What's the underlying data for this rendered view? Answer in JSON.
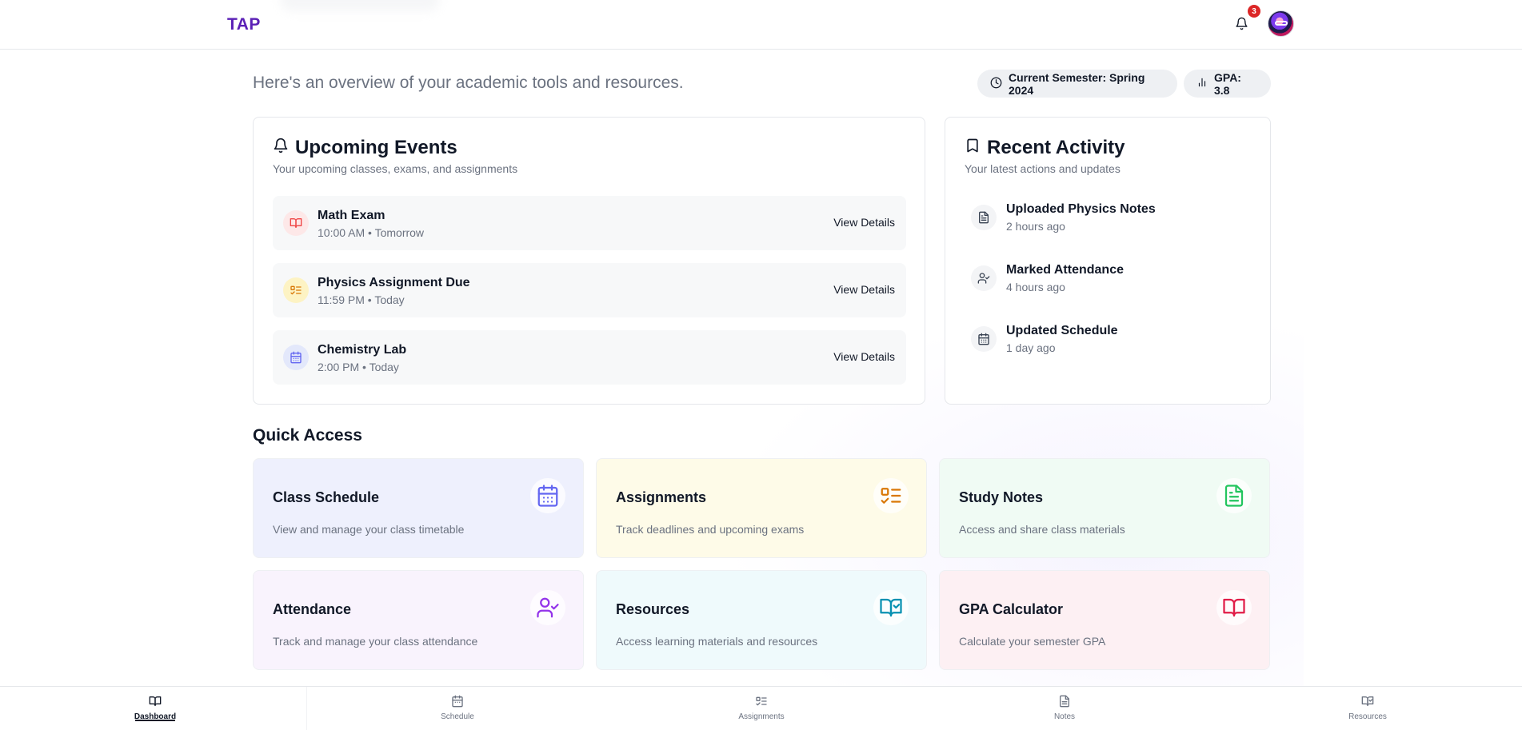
{
  "header": {
    "logo": "TAP",
    "notification_count": "3"
  },
  "overview": {
    "text": "Here's an overview of your academic tools and resources.",
    "semester": "Current Semester: Spring 2024",
    "gpa": "GPA: 3.8"
  },
  "events": {
    "title": "Upcoming Events",
    "subtitle": "Your upcoming classes, exams, and assignments",
    "items": [
      {
        "name": "Math Exam",
        "time": "10:00 AM • Tomorrow",
        "action": "View Details",
        "icon": "book-open-icon",
        "color": "#ef4444",
        "bg": "#fde8e8"
      },
      {
        "name": "Physics Assignment Due",
        "time": "11:59 PM • Today",
        "action": "View Details",
        "icon": "list-checks-icon",
        "color": "#d97706",
        "bg": "#fdf3c4"
      },
      {
        "name": "Chemistry Lab",
        "time": "2:00 PM • Today",
        "action": "View Details",
        "icon": "calendar-icon",
        "color": "#6366f1",
        "bg": "#e3e8fb"
      }
    ]
  },
  "activity": {
    "title": "Recent Activity",
    "subtitle": "Your latest actions and updates",
    "items": [
      {
        "name": "Uploaded Physics Notes",
        "time": "2 hours ago",
        "icon": "file-text-icon"
      },
      {
        "name": "Marked Attendance",
        "time": "4 hours ago",
        "icon": "user-check-icon"
      },
      {
        "name": "Updated Schedule",
        "time": "1 day ago",
        "icon": "calendar-icon"
      }
    ]
  },
  "quick_access": {
    "title": "Quick Access",
    "tiles": [
      {
        "name": "Class Schedule",
        "desc": "View and manage your class timetable",
        "icon": "calendar-icon",
        "color": "#6366f1",
        "bg": "#eef0fd"
      },
      {
        "name": "Assignments",
        "desc": "Track deadlines and upcoming exams",
        "icon": "list-checks-icon",
        "color": "#d97706",
        "bg": "#fefbe8"
      },
      {
        "name": "Study Notes",
        "desc": "Access and share class materials",
        "icon": "file-text-icon",
        "color": "#22c55e",
        "bg": "#f0fbf4"
      },
      {
        "name": "Attendance",
        "desc": "Track and manage your class attendance",
        "icon": "user-check-icon",
        "color": "#9333ea",
        "bg": "#f9f3fd"
      },
      {
        "name": "Resources",
        "desc": "Access learning materials and resources",
        "icon": "book-check-icon",
        "color": "#0891b2",
        "bg": "#effafc"
      },
      {
        "name": "GPA Calculator",
        "desc": "Calculate your semester GPA",
        "icon": "book-open-icon",
        "color": "#e11d48",
        "bg": "#fdf0f3"
      }
    ]
  },
  "bottom_nav": {
    "items": [
      {
        "label": "Dashboard",
        "icon": "book-open-icon",
        "active": true
      },
      {
        "label": "Schedule",
        "icon": "calendar-icon",
        "active": false
      },
      {
        "label": "Assignments",
        "icon": "list-checks-icon",
        "active": false
      },
      {
        "label": "Notes",
        "icon": "file-text-icon",
        "active": false
      },
      {
        "label": "Resources",
        "icon": "book-check-icon",
        "active": false
      }
    ]
  }
}
